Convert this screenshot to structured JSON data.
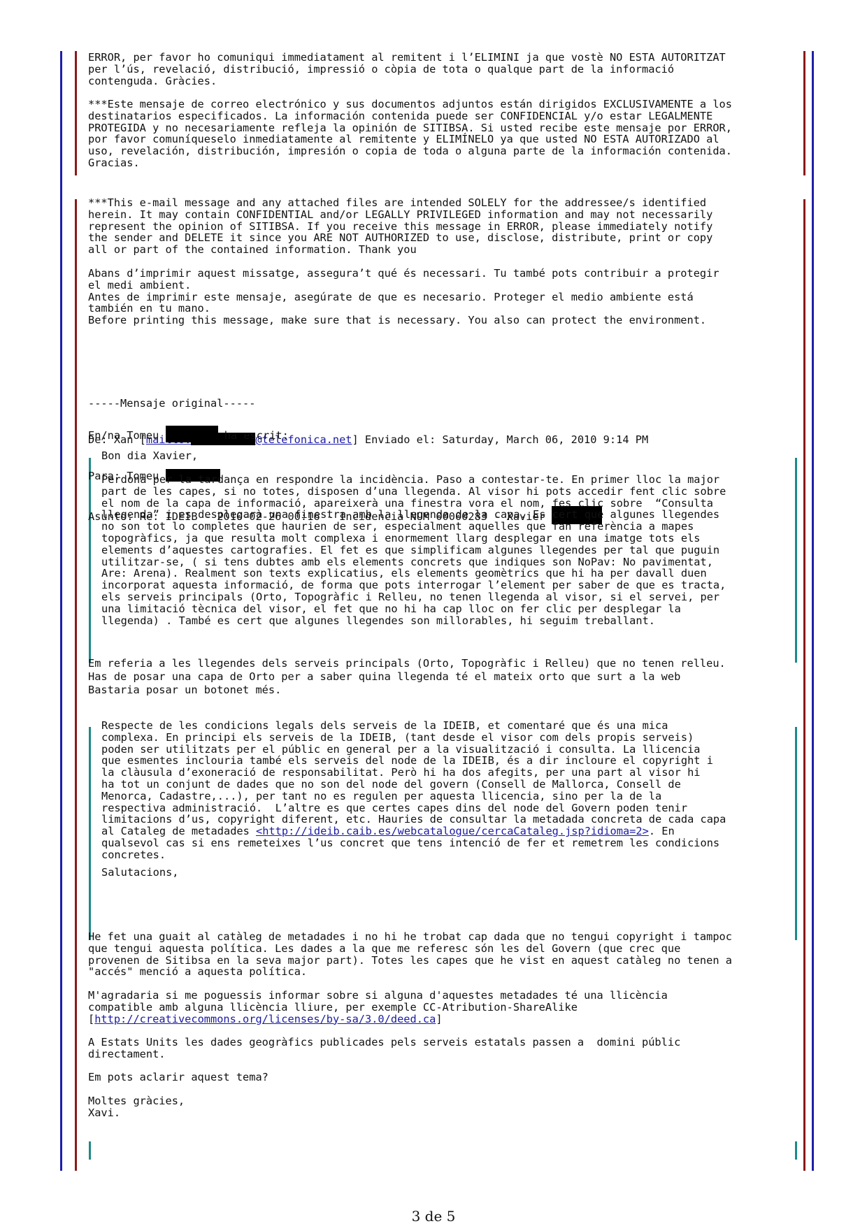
{
  "disclaimer_cat_tail": [
    "ERROR, per favor ho comuniqui immediatament al remitent i l’ELIMINI ja que vostè NO ESTA AUTORITZAT",
    "per l’ús, revelació, distribució, impressió o còpia de tota o qualque part de la informació",
    "contenguda. Gràcies."
  ],
  "disclaimer_es": [
    "***Este mensaje de correo electrónico y sus documentos adjuntos están dirigidos EXCLUSIVAMENTE a los",
    "destinatarios especificados. La información contenida puede ser CONFIDENCIAL y/o estar LEGALMENTE",
    "PROTEGIDA y no necesariamente refleja la opinión de SITIBSA. Si usted recibe este mensaje por ERROR,",
    "por favor comuníqueselo inmediatamente al remitente y ELIMÍNELO ya que usted NO ESTA AUTORIZADO al",
    "uso, revelación, distribución, impresión o copia de toda o alguna parte de la información contenida.",
    "Gracias."
  ],
  "disclaimer_en": [
    "***This e-mail message and any attached files are intended SOLELY for the addressee/s identified",
    "herein. It may contain CONFIDENTIAL and/or LEGALLY PRIVILEGED information and may not necessarily",
    "represent the opinion of SITIBSA. If you receive this message in ERROR, please immediately notify",
    "the sender and DELETE it since you ARE NOT AUTHORIZED to use, disclose, distribute, print or copy",
    "all or part of the contained information. Thank you"
  ],
  "print_notice": [
    "Abans d’imprimir aquest missatge, assegura’t qué és necessari. Tu també pots contribuir a protegir",
    "el medi ambient.",
    "Antes de imprimir este mensaje, asegúrate de que es necesario. Proteger el medio ambiente está",
    "también en tu mano.",
    "Before printing this message, make sure that is necessary. You also can protect the environment."
  ],
  "original_header": {
    "separator": "-----Mensaje original-----",
    "from_prefix": "De: Xan [",
    "from_mailto": "mailto:",
    "from_domain": "@telefonica.net",
    "from_sent": "] Enviado el: Saturday, March 06, 2010 9:14 PM",
    "to_prefix": "Para: Tomeu ",
    "subject": "Asunto: Re: IDEIB - 2010-02-26 00:16 - Incidencia NUM 00000283 - Xavier ",
    "wrote_prefix": "En/na Tomeu ",
    "wrote_suffix": " ha escrit:"
  },
  "quote1": {
    "greeting": "Bon dia Xavier,",
    "body": [
      "Perdona per la tardança en respondre la incidència. Paso a contestar-te. En primer lloc la major",
      "part de les capes, si no totes, disposen d’una llegenda. Al visor hi pots accedir fent clic sobre",
      "el nom de la capa de informació, apareixerà una finestra vora el nom, fes clic sobre  “Consulta",
      "llegenda” i es desplegarà una finestra amb la llegenda de la capa. Es cert que algunes llegendes",
      "no son tot lo completes que haurien de ser, especialment aquelles que fan referència a mapes",
      "topogràfics, ja que resulta molt complexa i enormement llarg desplegar en una imatge tots els",
      "elements d’aquestes cartografies. El fet es que simplificam algunes llegendes per tal que puguin",
      "utilitzar-se, ( si tens dubtes amb els elements concrets que indiques son NoPav: No pavimentat,",
      "Are: Arena). Realment son texts explicatius, els elements geomètrics que hi ha per davall duen",
      "incorporat aquesta informació, de forma que pots interrogar l’element per saber de que es tracta,",
      "els serveis principals (Orto, Topogràfic i Relleu, no tenen llegenda al visor, si el servei, per",
      "una limitació tècnica del visor, el fet que no hi ha cap lloc on fer clic per desplegar la",
      "llegenda) . També es cert que algunes llegendes son millorables, hi seguim treballant."
    ]
  },
  "reply1": [
    "Em referia a les llegendes dels serveis principals (Orto, Topogràfic i Relleu) que no tenen relleu.",
    "Has de posar una capa de Orto per a saber quina llegenda té el mateix orto que surt a la web",
    "Bastaria posar un botonet més."
  ],
  "quote2": {
    "body_before_link": [
      "Respecte de les condicions legals dels serveis de la IDEIB, et comentaré que és una mica",
      "complexa. En principi els serveis de la IDEIB, (tant desde el visor com dels propis serveis)",
      "poden ser utilitzats per el públic en general per a la visualització i consulta. La llicencia",
      "que esmentes inclouria també els serveis del node de la IDEIB, és a dir incloure el copyright i",
      "la clàusula d’exoneració de responsabilitat. Però hi ha dos afegits, per una part al visor hi",
      "ha tot un conjunt de dades que no son del node del govern (Consell de Mallorca, Consell de",
      "Menorca, Cadastre,...), per tant no es regulen per aquesta llicencia, sino per la de la",
      "respectiva administració.  L’altre es que certes capes dins del node del Govern poden tenir",
      "limitacions d’us, copyright diferent, etc. Hauries de consultar la metadada concreta de cada capa"
    ],
    "link_prefix": "al Cataleg de metadades ",
    "link_text": "<http://ideib.caib.es/webcatalogue/cercaCataleg.jsp?idioma=2>",
    "link_suffix": ". En",
    "body_after_link": [
      "qualsevol cas si ens remeteixes l’us concret que tens intenció de fer et remetrem les condicions",
      "concretes."
    ],
    "closing": "Salutacions,"
  },
  "reply2": [
    "He fet una guait al catàleg de metadades i no hi he trobat cap dada que no tengui copyright i tampoc",
    "que tengui aquesta política. Les dades a la que me referesc són les del Govern (que crec que",
    "provenen de Sitibsa en la seva major part). Totes les capes que he vist en aquest catàleg no tenen a",
    "\"accés\" menció a aquesta política."
  ],
  "reply3": {
    "lines": [
      "M'agradaria si me poguessis informar sobre si alguna d'aquestes metadades té una llicència",
      "compatible amb alguna llicència lliure, per exemple CC-Atribution-ShareAlike"
    ],
    "link_open": "[",
    "link_text": "http://creativecommons.org/licenses/by-sa/3.0/deed.ca",
    "link_close": "]"
  },
  "reply4": [
    "A Estats Units les dades geogràfics publicades pels serveis estatals passen a  domini públic",
    "directament."
  ],
  "reply5": "Em pots aclarir aquest tema?",
  "signature": [
    "Moltes gràcies,",
    "Xavi."
  ],
  "footer": {
    "page_label": "3 de 5"
  },
  "colors": {
    "outer_bar": "#1f1fa8",
    "inner_bar": "#8b1a1a",
    "quote_bar": "#1d8a8a",
    "link": "#1a1aa6"
  }
}
